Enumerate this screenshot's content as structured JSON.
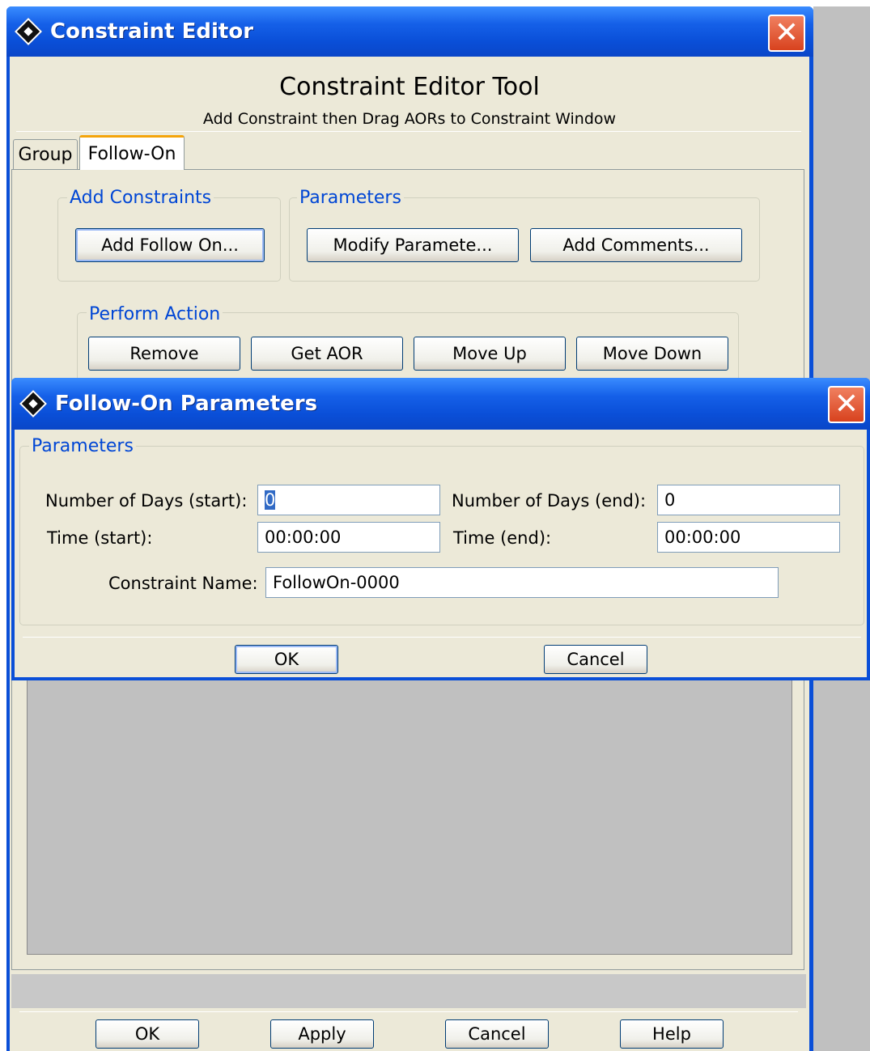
{
  "main_window": {
    "title": "Constraint Editor",
    "tool_title": "Constraint Editor Tool",
    "subtitle": "Add Constraint then Drag AORs to Constraint Window",
    "tabs": [
      {
        "label": "Group",
        "active": false
      },
      {
        "label": "Follow-On",
        "active": true
      }
    ],
    "add_constraints": {
      "title": "Add Constraints",
      "button": "Add Follow On..."
    },
    "parameters": {
      "title": "Parameters",
      "modify_button": "Modify Paramete...",
      "comments_button": "Add Comments..."
    },
    "perform_action": {
      "title": "Perform Action",
      "buttons": [
        "Remove",
        "Get AOR",
        "Move Up",
        "Move Down"
      ]
    },
    "footer_buttons": {
      "ok": "OK",
      "apply": "Apply",
      "cancel": "Cancel",
      "help": "Help"
    }
  },
  "dialog": {
    "title": "Follow-On Parameters",
    "group_title": "Parameters",
    "fields": {
      "days_start": {
        "label": "Number of Days (start):",
        "value": "0"
      },
      "days_end": {
        "label": "Number of Days (end):",
        "value": "0"
      },
      "time_start": {
        "label": "Time (start):",
        "value": "00:00:00"
      },
      "time_end": {
        "label": "Time (end):",
        "value": "00:00:00"
      },
      "constraint_name": {
        "label": "Constraint Name:",
        "value": "FollowOn-0000"
      }
    },
    "ok_label": "OK",
    "cancel_label": "Cancel"
  },
  "colors": {
    "titlebar": "#0a4fd8",
    "window_face": "#ece9d8",
    "group_title": "#0046d5",
    "close_button": "#d8421e",
    "list_area": "#c0c0c0"
  },
  "icons": [
    "app-diamond-icon",
    "close-icon"
  ]
}
